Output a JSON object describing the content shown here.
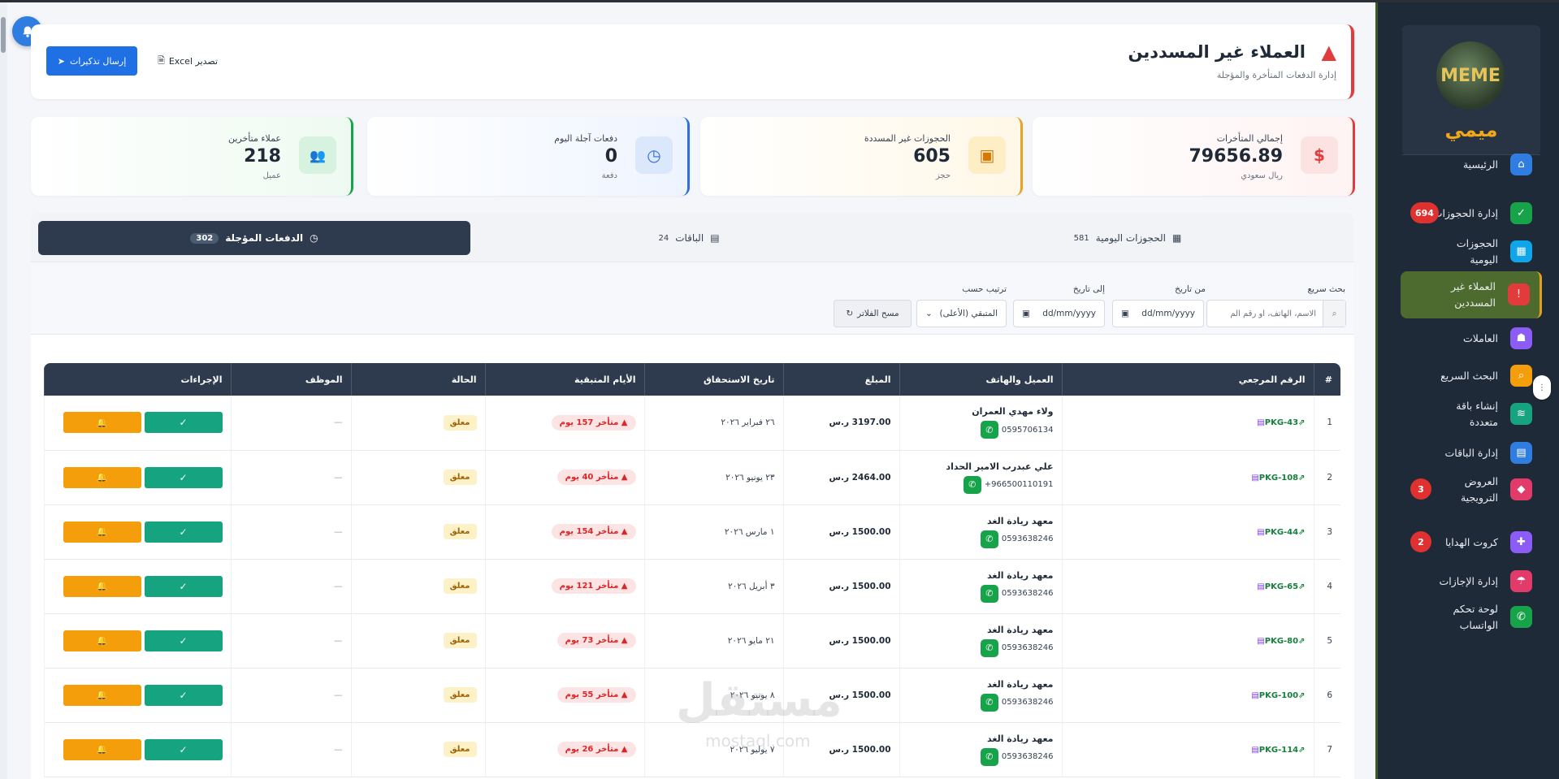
{
  "header": {
    "title": "العملاء غير المسددين",
    "subtitle": "إدارة الدفعات المتأخرة والمؤجلة",
    "send_label": "إرسال تذكيرات",
    "export_label": "تصدير Excel"
  },
  "stats": [
    {
      "label": "إجمالي المتأخرات",
      "value": "79656.89",
      "unit": "ريال سعودي",
      "icon": "dollar-icon",
      "symbol": "$",
      "color": "#e23b3b"
    },
    {
      "label": "الحجوزات غير المسددة",
      "value": "605",
      "unit": "حجز",
      "icon": "calendar-x-icon",
      "symbol": "▣",
      "color": "#e6a321"
    },
    {
      "label": "دفعات آجلة اليوم",
      "value": "0",
      "unit": "دفعة",
      "icon": "clock-icon",
      "symbol": "◷",
      "color": "#2f6fd6"
    },
    {
      "label": "عملاء متأخرين",
      "value": "218",
      "unit": "عميل",
      "icon": "users-icon",
      "symbol": "👥",
      "color": "#16a34a"
    }
  ],
  "tabs": [
    {
      "label": "الحجوزات اليومية",
      "count": "581"
    },
    {
      "label": "الباقات",
      "count": "24"
    },
    {
      "label": "الدفعات المؤجلة",
      "count": "302"
    }
  ],
  "filters": {
    "search_label": "بحث سريع",
    "search_placeholder": "الاسم، الهاتف، أو رقم الم",
    "from_label": "من تاريخ",
    "to_label": "إلى تاريخ",
    "date_placeholder": "dd/mm/yyyy",
    "sort_label": "ترتيب حسب",
    "sort_value": "المتبقي (الأعلى)",
    "clear_label": "مسح الفلاتر"
  },
  "table": {
    "headers": [
      "#",
      "الرقم المرجعي",
      "العميل والهاتف",
      "المبلغ",
      "تاريخ الاستحقاق",
      "الأيام المتبقية",
      "الحالة",
      "الموظف",
      "الإجراءات"
    ],
    "rows": [
      {
        "n": "1",
        "ref": "PKG-43",
        "name": "ولاء مهدي العمران",
        "phone": "0595706134",
        "amount": "3197.00 ر.س",
        "due": "٢٦ فبراير ٢٠٢٦",
        "late": "متأخر 157 يوم",
        "status": "معلق",
        "staff": "—"
      },
      {
        "n": "2",
        "ref": "PKG-108",
        "name": "علي عبدرب الامير الحداد",
        "phone": "+966500110191",
        "amount": "2464.00 ر.س",
        "due": "٢٣ يونيو ٢٠٢٦",
        "late": "متأخر 40 يوم",
        "status": "معلق",
        "staff": "—"
      },
      {
        "n": "3",
        "ref": "PKG-44",
        "name": "معهد ريادة الغد",
        "phone": "0593638246",
        "amount": "1500.00 ر.س",
        "due": "١ مارس ٢٠٢٦",
        "late": "متأخر 154 يوم",
        "status": "معلق",
        "staff": "—"
      },
      {
        "n": "4",
        "ref": "PKG-65",
        "name": "معهد ريادة الغد",
        "phone": "0593638246",
        "amount": "1500.00 ر.س",
        "due": "٣ أبريل ٢٠٢٦",
        "late": "متأخر 121 يوم",
        "status": "معلق",
        "staff": "—"
      },
      {
        "n": "5",
        "ref": "PKG-80",
        "name": "معهد ريادة الغد",
        "phone": "0593638246",
        "amount": "1500.00 ر.س",
        "due": "٢١ مايو ٢٠٢٦",
        "late": "متأخر 73 يوم",
        "status": "معلق",
        "staff": "—"
      },
      {
        "n": "6",
        "ref": "PKG-100",
        "name": "معهد ريادة الغد",
        "phone": "0593638246",
        "amount": "1500.00 ر.س",
        "due": "٨ يونيو ٢٠٢٦",
        "late": "متأخر 55 يوم",
        "status": "معلق",
        "staff": "—"
      },
      {
        "n": "7",
        "ref": "PKG-114",
        "name": "معهد ريادة الغد",
        "phone": "0593638246",
        "amount": "1500.00 ر.س",
        "due": "٧ يوليو ٢٠٢٦",
        "late": "متأخر 26 يوم",
        "status": "معلق",
        "staff": "—"
      }
    ]
  },
  "sidebar": {
    "brand": "ميمي",
    "logo_text": "MEME",
    "items": [
      {
        "label": "الرئيسية",
        "icon": "home-icon",
        "symbol": "⌂",
        "color": "#2f7de1",
        "badge": ""
      },
      {
        "label": "إدارة الحجوزات",
        "icon": "calendar-check-icon",
        "symbol": "✓",
        "color": "#16a34a",
        "badge": "694"
      },
      {
        "label": "الحجوزات اليومية",
        "icon": "calendar-icon",
        "symbol": "▦",
        "color": "#0ea5e9",
        "badge": ""
      },
      {
        "label": "العملاء غير المسددين",
        "icon": "warning-icon",
        "symbol": "!",
        "color": "#e23b3b",
        "badge": ""
      },
      {
        "label": "العاملات",
        "icon": "worker-icon",
        "symbol": "☗",
        "color": "#8b5cf6",
        "badge": ""
      },
      {
        "label": "البحث السريع",
        "icon": "search-icon",
        "symbol": "⌕",
        "color": "#f59e0b",
        "badge": ""
      },
      {
        "label": "إنشاء باقة متعددة",
        "icon": "layers-icon",
        "symbol": "≋",
        "color": "#16a37f",
        "badge": ""
      },
      {
        "label": "إدارة الباقات",
        "icon": "boxes-icon",
        "symbol": "▤",
        "color": "#2f7de1",
        "badge": ""
      },
      {
        "label": "العروض الترويجية",
        "icon": "tag-icon",
        "symbol": "◆",
        "color": "#e23b6a",
        "badge": "3"
      },
      {
        "label": "كروت الهدايا",
        "icon": "gift-icon",
        "symbol": "✚",
        "color": "#8b5cf6",
        "badge": "2"
      },
      {
        "label": "إدارة الإجازات",
        "icon": "umbrella-icon",
        "symbol": "☂",
        "color": "#e23b6a",
        "badge": ""
      },
      {
        "label": "لوحة تحكم الواتساب",
        "icon": "whatsapp-icon",
        "symbol": "✆",
        "color": "#16a34a",
        "badge": ""
      }
    ]
  },
  "watermark": {
    "main": "مستقل",
    "sub": "mostaql.com"
  }
}
